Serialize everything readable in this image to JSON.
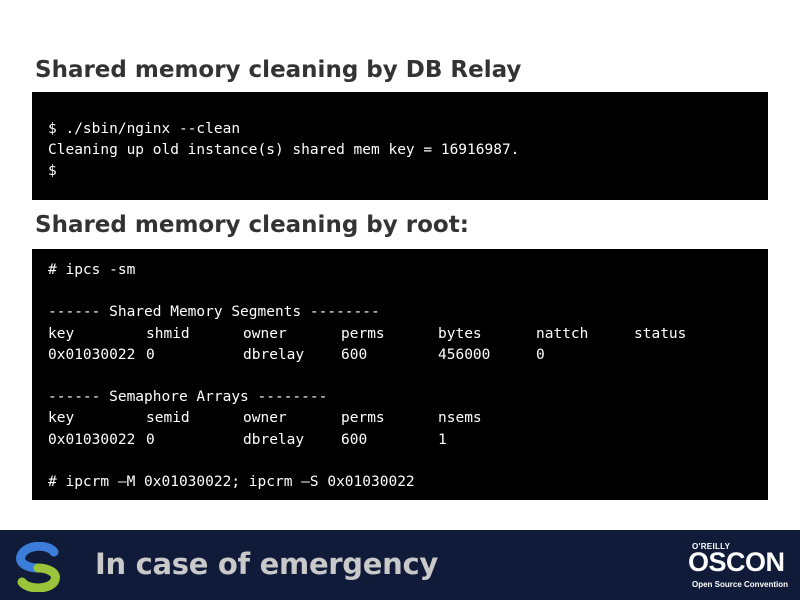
{
  "slide": {
    "heading_1": "Shared memory cleaning by DB Relay",
    "heading_2": "Shared memory cleaning by root:"
  },
  "terminal_1": {
    "lines": [
      "$ ./sbin/nginx --clean",
      "Cleaning up old instance(s) shared mem key = 16916987.",
      "$"
    ]
  },
  "terminal_2": {
    "command_1": "# ipcs -sm",
    "shm_header": "------ Shared Memory Segments --------",
    "shm_columns": [
      "key",
      "shmid",
      "owner",
      "perms",
      "bytes",
      "nattch",
      "status"
    ],
    "shm_row": [
      "0x01030022",
      "0",
      "dbrelay",
      "600",
      "456000",
      "0",
      ""
    ],
    "sem_header": "------ Semaphore Arrays --------",
    "sem_columns": [
      "key",
      "semid",
      "owner",
      "perms",
      "nsems"
    ],
    "sem_row": [
      "0x01030022",
      "0",
      "dbrelay",
      "600",
      "1"
    ],
    "command_2": "# ipcrm –M 0x01030022; ipcrm –S 0x01030022"
  },
  "footer": {
    "title": "In case of emergency",
    "logo_right": {
      "publisher": "O'REILLY",
      "name": "OSCON",
      "tagline": "Open Source Convention"
    },
    "logo_left_icon": "s-swirl-icon",
    "colors": {
      "band": "#0f1b38",
      "title": "#c9c9c9",
      "logo_blue": "#3b7dd8",
      "logo_green": "#9cc43a"
    }
  }
}
